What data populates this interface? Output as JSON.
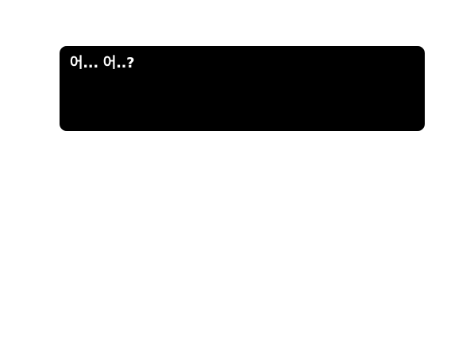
{
  "dialogue": {
    "text": "어... 어..?"
  },
  "colors": {
    "box_background": "#000000",
    "text": "#ffffff",
    "page_background": "#ffffff"
  }
}
